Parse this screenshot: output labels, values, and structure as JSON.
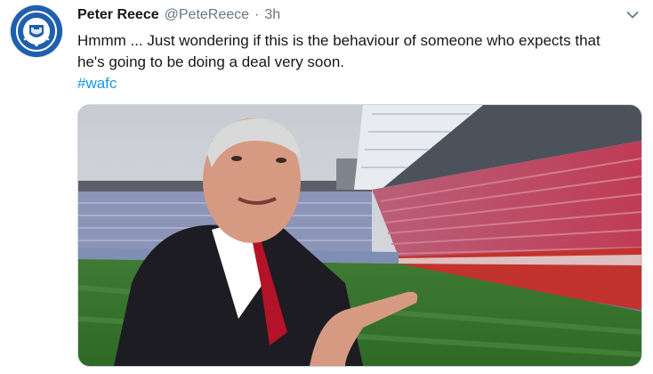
{
  "tweet": {
    "author_name": "Peter Reece",
    "author_handle": "@PeteReece",
    "separator": "·",
    "time": "3h",
    "text": "Hmmm ... Just wondering if this is the behaviour of someone who expects that he's going to be doing a deal very soon.",
    "hashtag": "#wafc",
    "avatar_icon": "club-crest-icon",
    "menu_icon": "chevron-down-icon",
    "media_description_icon": "stadium-video-frame"
  },
  "colors": {
    "text": "#14171a",
    "secondary": "#657786",
    "link": "#1b95e0",
    "avatar_blue": "#1f5fae"
  }
}
